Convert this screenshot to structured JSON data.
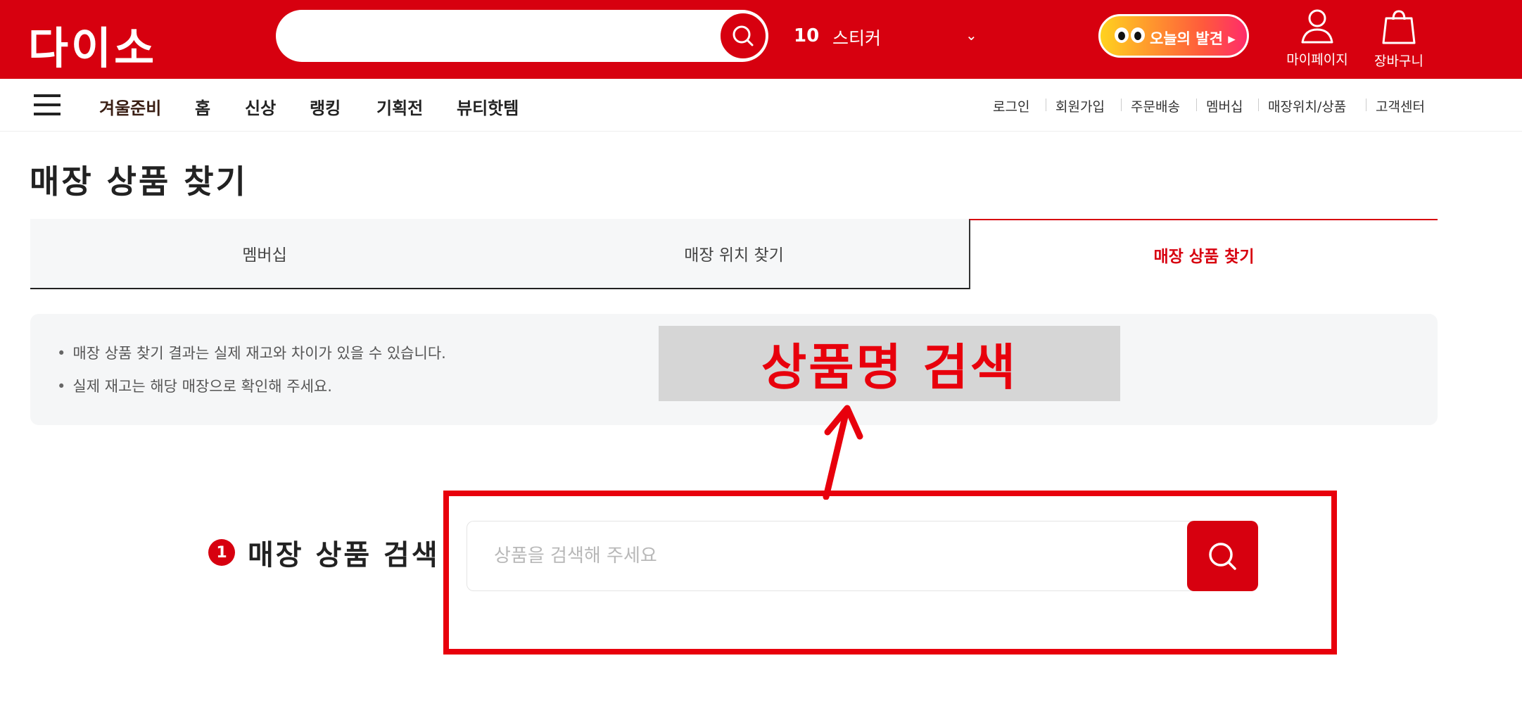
{
  "header": {
    "logo_text": "다이소",
    "search": {
      "value": "",
      "placeholder": ""
    },
    "rank_number": "10",
    "rank_keyword": "스티커",
    "discover_label": "오늘의 발견 ▸",
    "mypage_label": "마이페이지",
    "cart_label": "장바구니"
  },
  "nav": {
    "items": [
      "겨울준비",
      "홈",
      "신상",
      "랭킹",
      "기획전",
      "뷰티핫템"
    ],
    "util_links": [
      "로그인",
      "회원가입",
      "주문배송",
      "멤버십",
      "매장위치/상품",
      "고객센터"
    ]
  },
  "page": {
    "title": "매장 상품 찾기",
    "tabs": [
      "멤버십",
      "매장 위치 찾기",
      "매장 상품 찾기"
    ],
    "active_tab": 2,
    "notices": [
      "매장 상품 찾기 결과는 실제 재고와 차이가 있을 수 있습니다.",
      "실제 재고는 해당 매장으로 확인해 주세요."
    ],
    "step_number": "1",
    "step_label": "매장 상품 검색",
    "product_search": {
      "value": "",
      "placeholder": "상품을 검색해 주세요"
    }
  },
  "annotation": {
    "callout_text": "상품명 검색"
  },
  "colors": {
    "brand": "#d7000f",
    "annotation": "#e8000c"
  }
}
